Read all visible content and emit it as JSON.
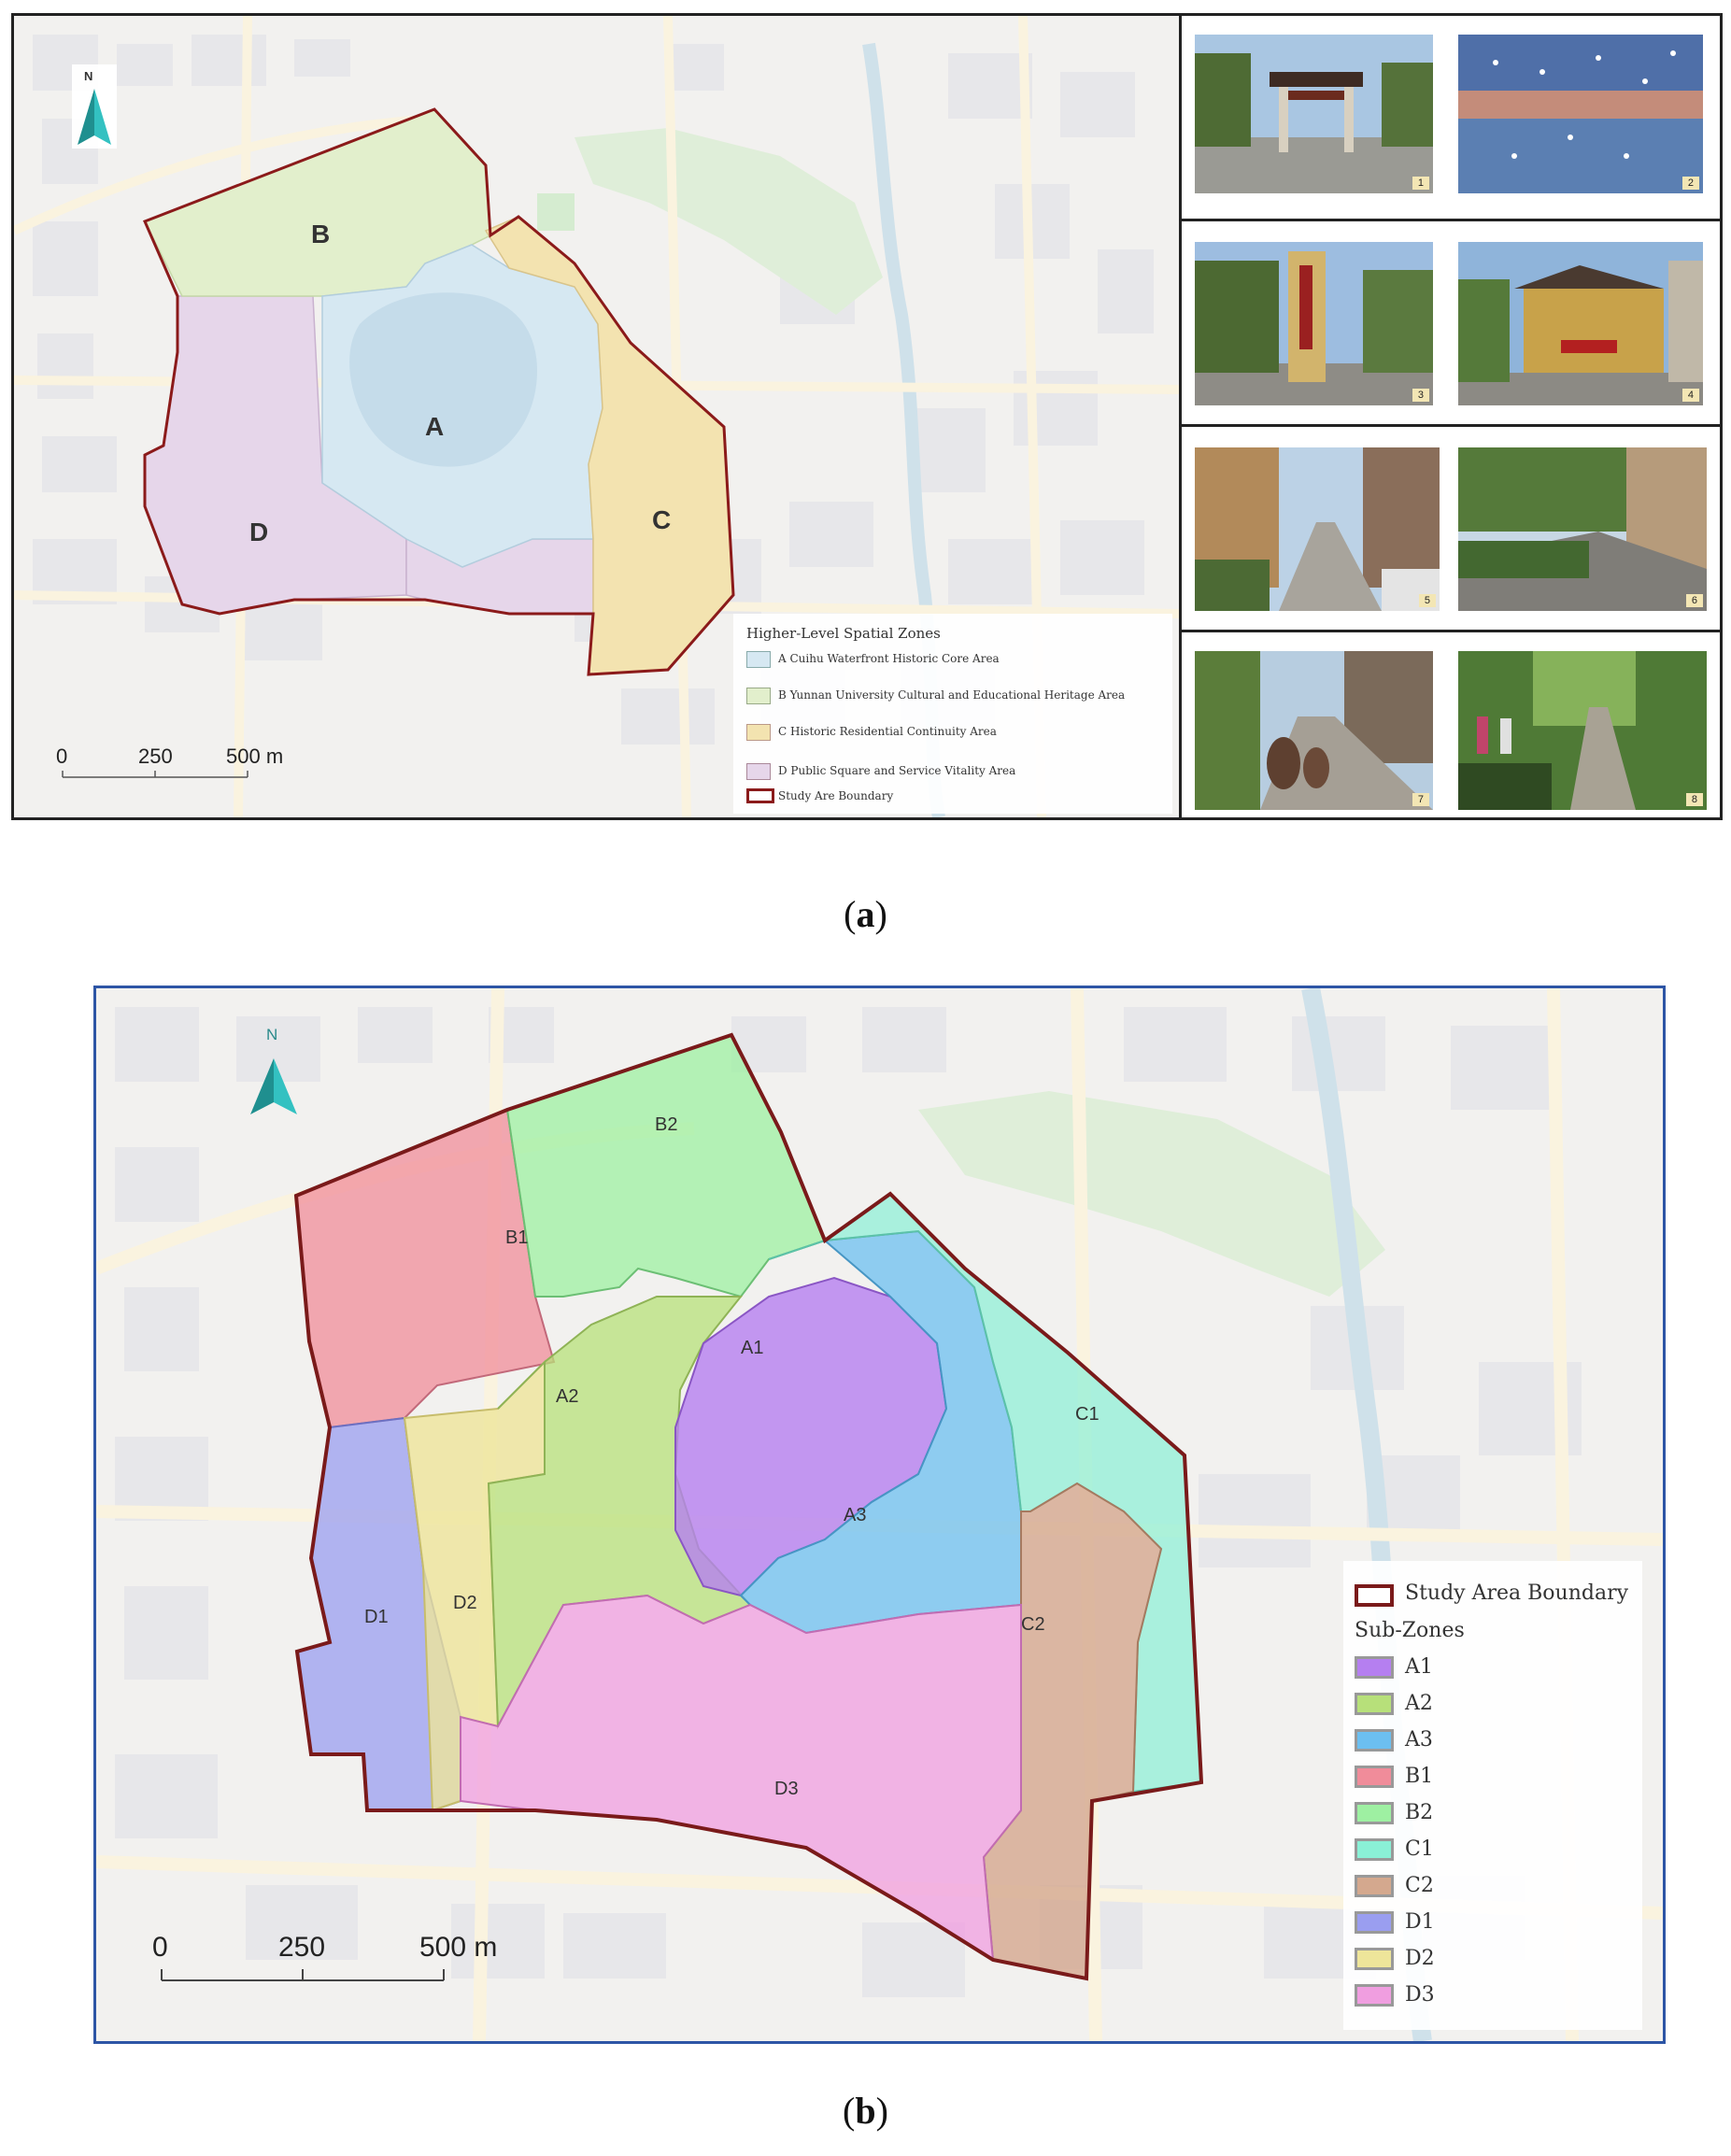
{
  "panel_a": {
    "caption_letter": "a",
    "north_label": "N",
    "zone_labels": {
      "A": "A",
      "B": "B",
      "C": "C",
      "D": "D"
    },
    "legend": {
      "title": "Higher-Level Spatial Zones",
      "items": [
        {
          "label": "A Cuihu Waterfront Historic Core Area",
          "color": "#d6e8f2"
        },
        {
          "label": "B Yunnan University Cultural and Educational Heritage Area",
          "color": "#e2efcc"
        },
        {
          "label": "C Historic Residential Continuity Area",
          "color": "#f3e3b0"
        },
        {
          "label": "D Public Square and Service Vitality Area",
          "color": "#e6d6ea"
        },
        {
          "label": "Study Are Boundary",
          "color": "#8b1a1a"
        }
      ]
    },
    "scale": {
      "t0": "0",
      "t1": "250",
      "t2": "500 m"
    },
    "photos": [
      {
        "num": "1",
        "icon": "memorial-archway-photo"
      },
      {
        "num": "2",
        "icon": "gulls-over-lake-photo"
      },
      {
        "num": "3",
        "icon": "university-gate-photo"
      },
      {
        "num": "4",
        "icon": "historic-building-photo"
      },
      {
        "num": "5",
        "icon": "residential-lane-photo"
      },
      {
        "num": "6",
        "icon": "tree-lined-street-photo"
      },
      {
        "num": "7",
        "icon": "street-sculpture-photo"
      },
      {
        "num": "8",
        "icon": "greenway-path-photo"
      }
    ]
  },
  "panel_b": {
    "caption_letter": "b",
    "north_label": "N",
    "zone_labels": {
      "A1": "A1",
      "A2": "A2",
      "A3": "A3",
      "B1": "B1",
      "B2": "B2",
      "C1": "C1",
      "C2": "C2",
      "D1": "D1",
      "D2": "D2",
      "D3": "D3"
    },
    "legend": {
      "boundary_label": "Study Area Boundary",
      "boundary_color": "#7a1a1a",
      "title": "Sub-Zones",
      "items": [
        {
          "label": "A1",
          "color": "#b57ff0"
        },
        {
          "label": "A2",
          "color": "#b7e07a"
        },
        {
          "label": "A3",
          "color": "#6cbff0"
        },
        {
          "label": "B1",
          "color": "#f08c9a"
        },
        {
          "label": "B2",
          "color": "#9ef0a2"
        },
        {
          "label": "C1",
          "color": "#8af0d6"
        },
        {
          "label": "C2",
          "color": "#d4a88e"
        },
        {
          "label": "D1",
          "color": "#9a9ef0"
        },
        {
          "label": "D2",
          "color": "#eee59a"
        },
        {
          "label": "D3",
          "color": "#f09ee0"
        }
      ]
    },
    "scale": {
      "t0": "0",
      "t1": "250",
      "t2": "500 m"
    }
  }
}
